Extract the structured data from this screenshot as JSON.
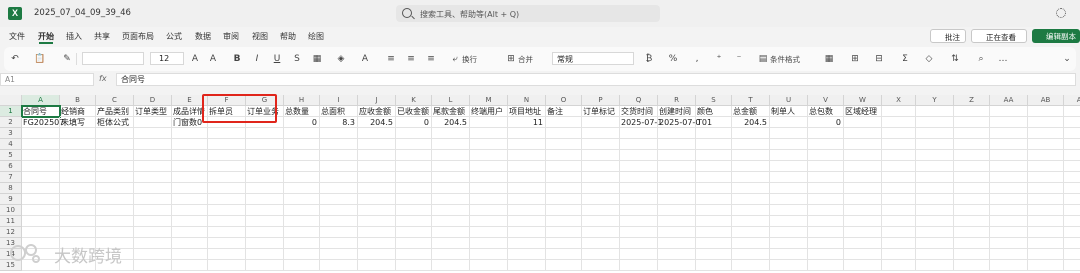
{
  "app": {
    "title": "2025_07_04_09_39_46",
    "logo": "X",
    "search_placeholder": "搜索工具、帮助等(Alt + Q)"
  },
  "menu": [
    "文件",
    "开始",
    "插入",
    "共享",
    "页面布局",
    "公式",
    "数据",
    "审阅",
    "视图",
    "帮助",
    "绘图"
  ],
  "actions": {
    "annotate": "批注",
    "viewing": "正在查看",
    "edit": "编辑副本"
  },
  "toolbar": {
    "font_size": "12",
    "wrap": "换行",
    "merge": "合并",
    "number_format": "常规",
    "conditional_format": "条件格式"
  },
  "formula": {
    "namebox": "A1",
    "content": "合同号"
  },
  "columns": [
    "A",
    "B",
    "C",
    "D",
    "E",
    "F",
    "G",
    "H",
    "I",
    "J",
    "K",
    "L",
    "M",
    "N",
    "O",
    "P",
    "Q",
    "R",
    "S",
    "T",
    "U",
    "V",
    "W",
    "X",
    "Y",
    "Z",
    "AA",
    "AB",
    "AC"
  ],
  "rows": [
    "1",
    "2",
    "3",
    "4",
    "5",
    "6",
    "7",
    "8",
    "9",
    "10",
    "11",
    "12",
    "13",
    "14",
    "15"
  ],
  "header_row": [
    "合同号",
    "经销商",
    "产品类别",
    "订单类型",
    "成品详情",
    "拆单员",
    "订单业务",
    "总数量",
    "总面积",
    "应收金额",
    "已收金额",
    "尾款金额",
    "终端用户",
    "项目地址",
    "备注",
    "订单标记",
    "交货时间",
    "创建时间",
    "颜色",
    "总金额",
    "制单人",
    "总包数",
    "区域经理"
  ],
  "data_row": [
    "FG202507",
    "未填写",
    "柜体公式",
    "",
    "门窗数0",
    "",
    "",
    "0",
    "8.3",
    "204.5",
    "0",
    "204.5",
    "",
    "11",
    "",
    "",
    "2025-07-1",
    "2025-07-0",
    "T01",
    "204.5",
    "",
    "0",
    ""
  ],
  "watermark": "大数跨境",
  "colors": {
    "accent": "#1d7a43",
    "highlight": "#e0251b"
  }
}
